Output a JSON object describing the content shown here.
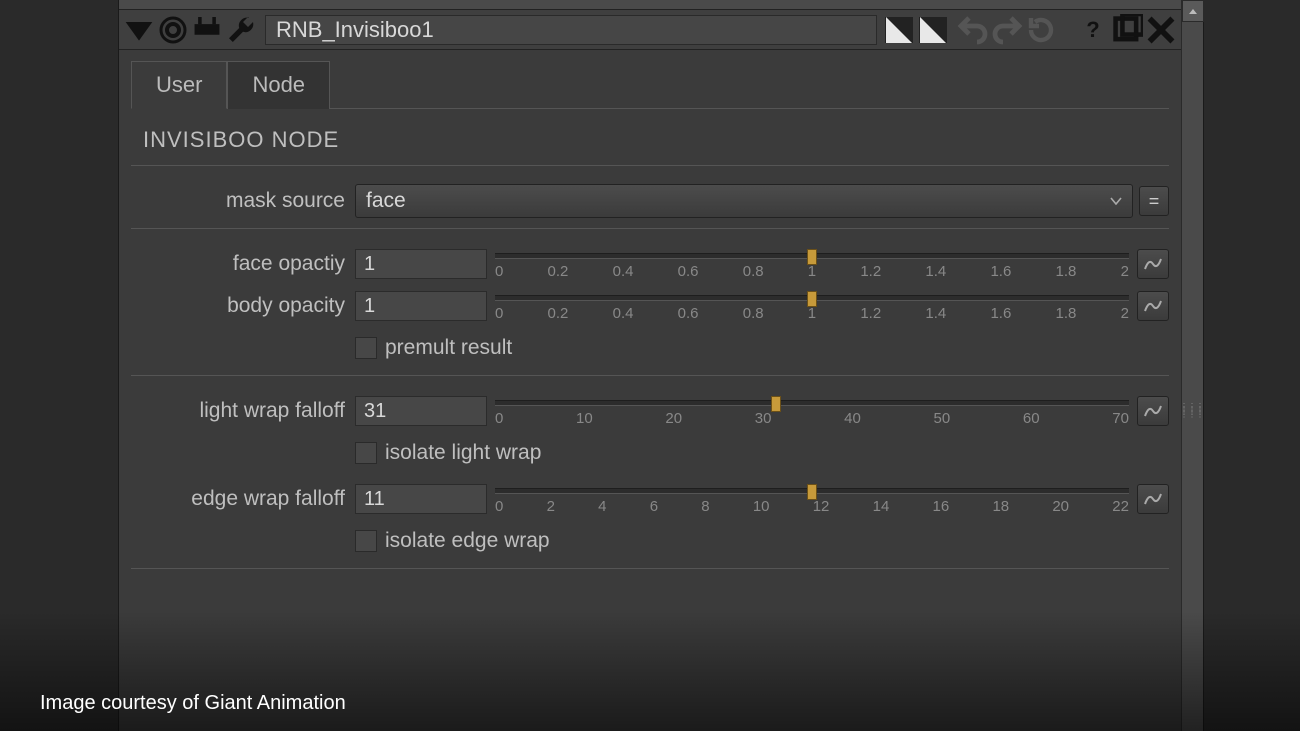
{
  "toolbar": {
    "title": "RNB_Invisiboo1"
  },
  "tabs": {
    "user": "User",
    "node": "Node"
  },
  "panel": {
    "title": "INVISIBOO NODE",
    "mask_source": {
      "label": "mask source",
      "value": "face"
    },
    "face_opacity": {
      "label": "face opactiy",
      "value": "1",
      "ticks": [
        "0",
        "0.2",
        "0.4",
        "0.6",
        "0.8",
        "1",
        "1.2",
        "1.4",
        "1.6",
        "1.8",
        "2"
      ],
      "handle_pct": 50
    },
    "body_opacity": {
      "label": "body opacity",
      "value": "1",
      "ticks": [
        "0",
        "0.2",
        "0.4",
        "0.6",
        "0.8",
        "1",
        "1.2",
        "1.4",
        "1.6",
        "1.8",
        "2"
      ],
      "handle_pct": 50
    },
    "premult": {
      "label": "premult result",
      "checked": false
    },
    "light_wrap": {
      "label": "light wrap falloff",
      "value": "31",
      "ticks": [
        "0",
        "10",
        "20",
        "30",
        "40",
        "50",
        "60",
        "70"
      ],
      "handle_pct": 44.3
    },
    "isolate_light": {
      "label": "isolate light wrap",
      "checked": false
    },
    "edge_wrap": {
      "label": "edge wrap falloff",
      "value": "11",
      "ticks": [
        "0",
        "2",
        "4",
        "6",
        "8",
        "10",
        "12",
        "14",
        "16",
        "18",
        "20",
        "22"
      ],
      "handle_pct": 50
    },
    "isolate_edge": {
      "label": "isolate edge wrap",
      "checked": false
    }
  },
  "credit": "Image courtesy of Giant Animation"
}
